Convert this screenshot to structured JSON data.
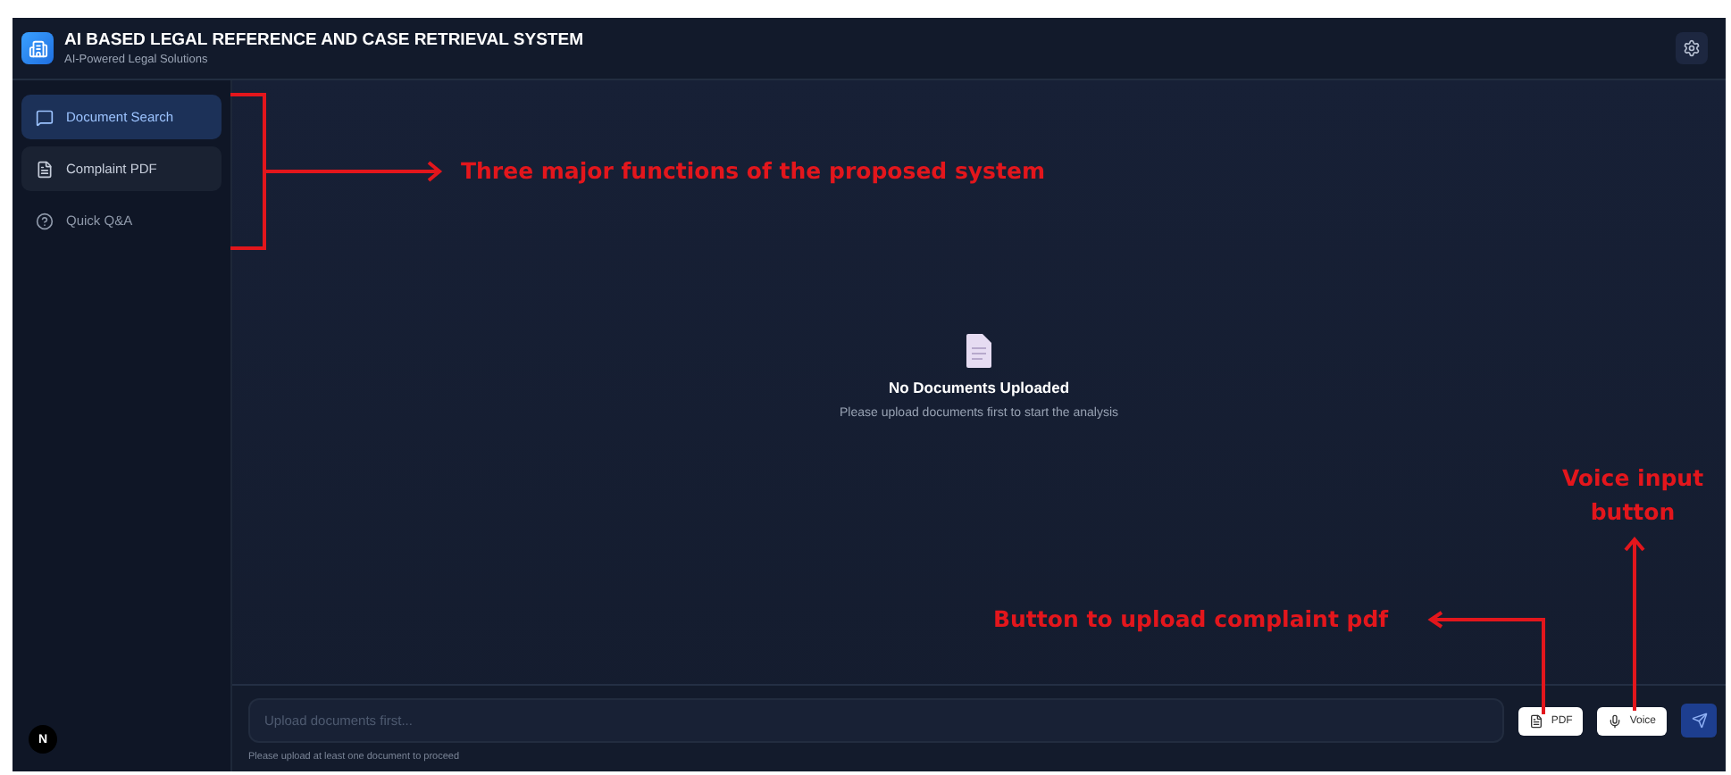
{
  "header": {
    "title": "AI BASED LEGAL REFERENCE AND CASE RETRIEVAL SYSTEM",
    "subtitle": "AI-Powered Legal Solutions"
  },
  "sidebar": {
    "items": [
      {
        "label": "Document Search",
        "kind": "chat",
        "selected": true,
        "hovered": false
      },
      {
        "label": "Complaint PDF",
        "kind": "file",
        "selected": false,
        "hovered": true
      },
      {
        "label": "Quick Q&A",
        "kind": "help",
        "selected": false,
        "hovered": false
      }
    ],
    "avatar": "N"
  },
  "empty_state": {
    "title": "No Documents Uploaded",
    "message": "Please upload documents first to start the analysis"
  },
  "composer": {
    "placeholder": "Upload documents first...",
    "hint": "Please upload at least one document to proceed",
    "buttons": [
      {
        "label": "PDF",
        "kind": "pdf"
      },
      {
        "label": "Voice",
        "kind": "voice"
      },
      {
        "kind": "send"
      }
    ]
  },
  "annotations": [
    {
      "text": "Three major functions of the proposed system",
      "kind": "bracket"
    },
    {
      "text": "Button to upload complaint pdf",
      "kind": "elbow"
    },
    {
      "text": "Voice input button",
      "kind": "up"
    }
  ]
}
